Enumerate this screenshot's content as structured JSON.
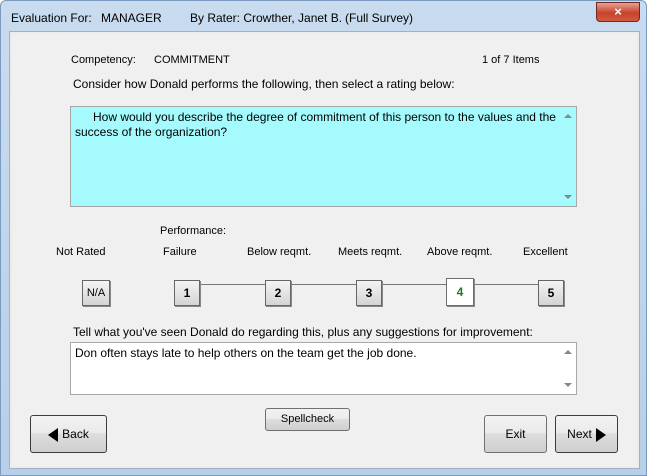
{
  "title_bar": {
    "evaluation_for": "Evaluation For:",
    "role": "MANAGER",
    "by_rater": "By Rater: Crowther, Janet B.",
    "survey_type": "(Full Survey)",
    "close_glyph": "×"
  },
  "competency": {
    "label": "Competency:",
    "value": "COMMITMENT",
    "item_count": "1 of 7 Items"
  },
  "instruction": "Consider how Donald performs the following, then select a rating below:",
  "question": "How would you describe the degree of commitment of this person to the values and the success of the organization?",
  "question_bg": "#a5fafd",
  "rating": {
    "performance_label": "Performance:",
    "scale_labels": [
      "Not Rated",
      "Failure",
      "Below reqmt.",
      "Meets reqmt.",
      "Above reqmt.",
      "Excellent"
    ],
    "buttons": [
      "N/A",
      "1",
      "2",
      "3",
      "4",
      "5"
    ],
    "selected": "4"
  },
  "comment": {
    "prompt": "Tell what you've seen Donald do regarding this, plus any suggestions for improvement:",
    "text": "Don often stays late to help others on the team get the job done."
  },
  "buttons": {
    "back": "Back",
    "spellcheck": "Spellcheck",
    "exit": "Exit",
    "next": "Next"
  }
}
